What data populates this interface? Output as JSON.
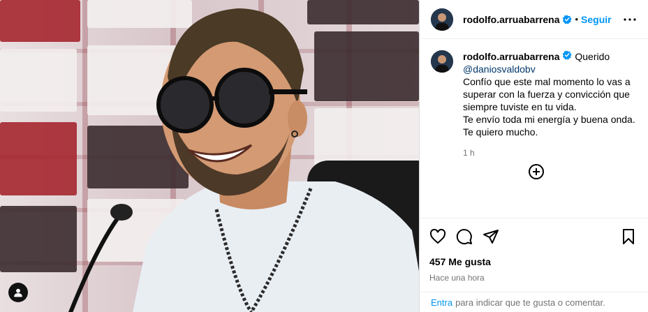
{
  "post": {
    "author": {
      "username": "rodolfo.arruabarrena",
      "verified": true,
      "follow_label": "Seguir",
      "separator": "•"
    },
    "caption": {
      "username": "rodolfo.arruabarrena",
      "lines": [
        "Querido",
        "@daniosvaldobv",
        "Confío que este mal momento lo vas a superar con la fuerza y convicción que siempre tuviste en tu vida.",
        "Te envío toda mi energía y buena onda.",
        "Te quiero mucho."
      ],
      "time": "1 h"
    },
    "likes": "457 Me gusta",
    "posted": "Hace una hora",
    "login_prompt": {
      "link": "Entra",
      "text": "para indicar que te gusta o comentar."
    }
  },
  "icons": {
    "verified": "verified-badge-icon",
    "more": "more-options-icon",
    "add_comment": "add-circle-icon",
    "like": "heart-icon",
    "comment": "comment-icon",
    "share": "share-icon",
    "save": "bookmark-icon",
    "tagged": "user-tag-icon"
  },
  "colors": {
    "accent": "#0095f6",
    "mention": "#00376b",
    "muted": "#737373",
    "verified": "#0095f6"
  }
}
